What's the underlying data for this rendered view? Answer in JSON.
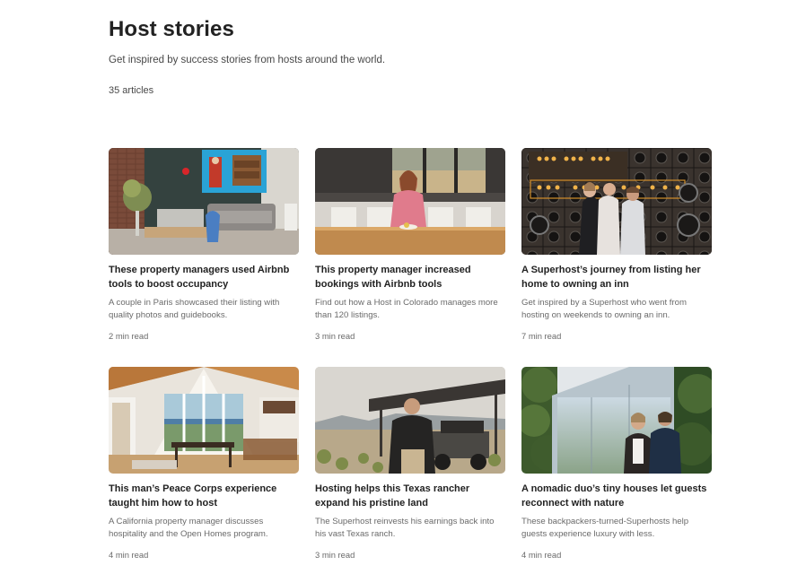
{
  "page": {
    "title": "Host stories",
    "subtitle": "Get inspired by success stories from hosts around the world.",
    "article_count": "35 articles"
  },
  "articles": [
    {
      "title": "These property managers used Airbnb tools to boost occupancy",
      "description": "A couple in Paris showcased their listing with quality photos and guidebooks.",
      "read_time": "2 min read",
      "image": "living-room-photo"
    },
    {
      "title": "This property manager increased bookings with Airbnb tools",
      "description": "Find out how a Host in Colorado manages more than 120 listings.",
      "read_time": "3 min read",
      "image": "kitchen-host-photo"
    },
    {
      "title": "A Superhost’s journey from listing her home to owning an inn",
      "description": "Get inspired by a Superhost who went from hosting on weekends to owning an inn.",
      "read_time": "7 min read",
      "image": "inn-sign-photo"
    },
    {
      "title": "This man’s Peace Corps experience taught him how to host",
      "description": "A California property manager discusses hospitality and the Open Homes program.",
      "read_time": "4 min read",
      "image": "cabin-interior-photo"
    },
    {
      "title": "Hosting helps this Texas rancher expand his pristine land",
      "description": "The Superhost reinvests his earnings back into his vast Texas ranch.",
      "read_time": "3 min read",
      "image": "rancher-photo"
    },
    {
      "title": "A nomadic duo’s tiny houses let guests reconnect with nature",
      "description": "These backpackers-turned-Superhosts help guests experience luxury with less.",
      "read_time": "4 min read",
      "image": "tiny-house-photo"
    }
  ]
}
